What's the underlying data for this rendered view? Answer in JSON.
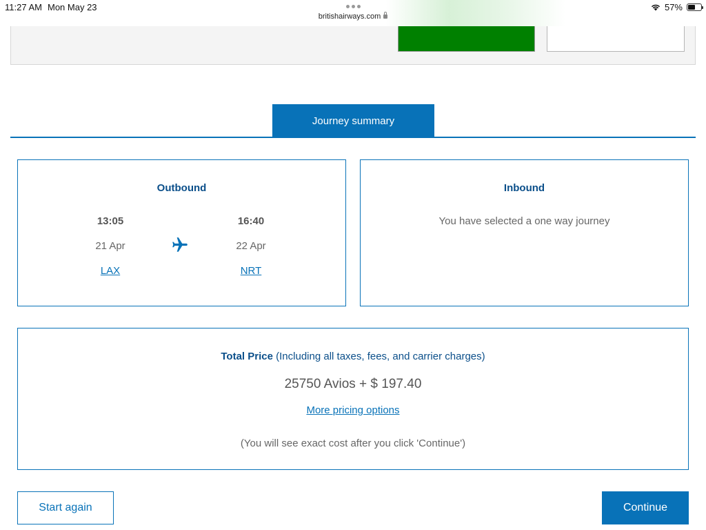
{
  "status_bar": {
    "time": "11:27 AM",
    "date": "Mon May 23",
    "url": "britishairways.com",
    "battery": "57%",
    "battery_level": 0.57
  },
  "journey": {
    "tab_label": "Journey summary",
    "outbound": {
      "title": "Outbound",
      "depart_time": "13:05",
      "arrive_time": "16:40",
      "depart_date": "21 Apr",
      "arrive_date": "22 Apr",
      "origin": "LAX",
      "destination": "NRT"
    },
    "inbound": {
      "title": "Inbound",
      "message": "You have selected a one way journey"
    }
  },
  "price": {
    "label": "Total Price",
    "qualifier": "(Including all taxes, fees, and carrier charges)",
    "amount": "25750 Avios + $ 197.40",
    "more_options": "More pricing options",
    "note": "(You will see exact cost after you click 'Continue')"
  },
  "actions": {
    "start_again": "Start again",
    "continue": "Continue"
  },
  "colors": {
    "accent": "#0872b8",
    "heading": "#0b4f8a",
    "green_button": "#008000"
  }
}
